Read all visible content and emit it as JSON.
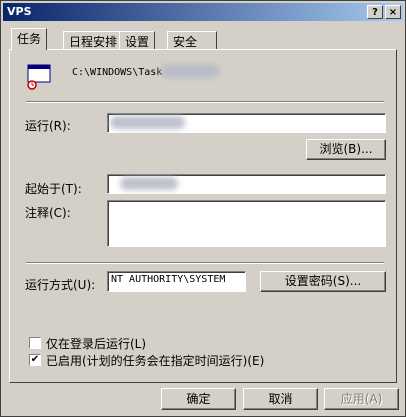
{
  "window": {
    "title": "VPS",
    "help_glyph": "?",
    "close_glyph": "×"
  },
  "tabs": [
    {
      "label": "任务"
    },
    {
      "label": "日程安排"
    },
    {
      "label": "设置"
    },
    {
      "label": "安全"
    }
  ],
  "task": {
    "path": "C:\\WINDOWS\\Task"
  },
  "fields": {
    "run_label": "运行(R):",
    "start_label": "起始于(T):",
    "comment_label": "注释(C):",
    "runas_label": "运行方式(U):",
    "runas_value": "NT AUTHORITY\\SYSTEM"
  },
  "buttons": {
    "browse": "浏览(B)...",
    "set_password": "设置密码(S)...",
    "ok": "确定",
    "cancel": "取消",
    "apply": "应用(A)"
  },
  "options": {
    "logged_on_only": {
      "label": "仅在登录后运行(L)",
      "checked": false
    },
    "enabled": {
      "label": "已启用(计划的任务会在指定时间运行)(E)",
      "checked": true,
      "check_glyph": "✔"
    }
  }
}
